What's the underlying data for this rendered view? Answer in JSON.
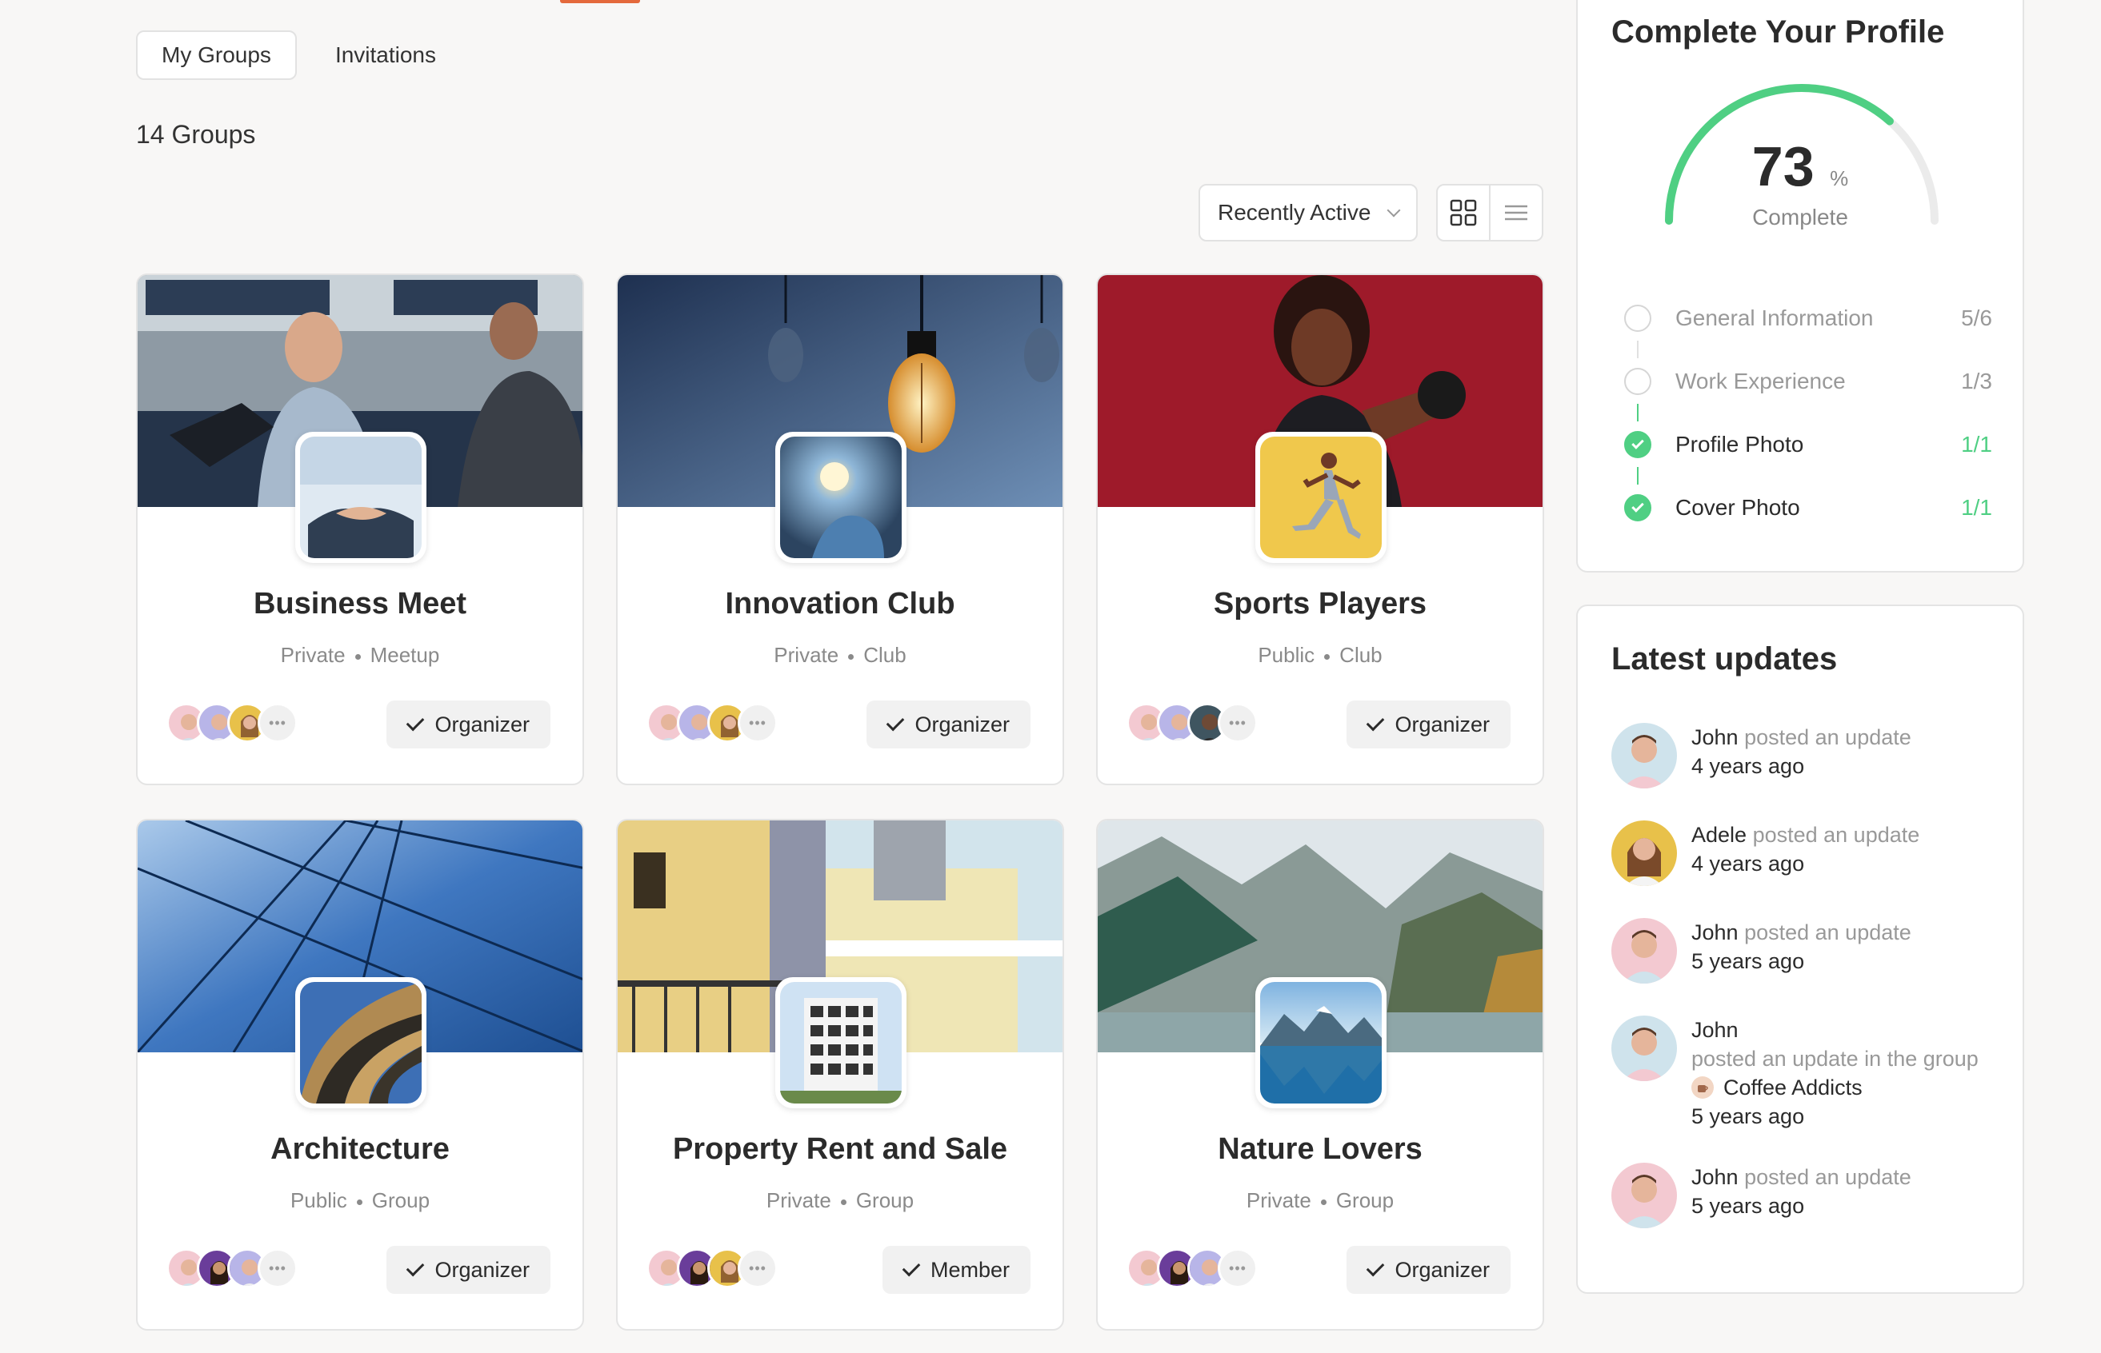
{
  "tabs": [
    {
      "label": "My Groups",
      "active": true
    },
    {
      "label": "Invitations",
      "active": false
    }
  ],
  "groups_count": "14 Groups",
  "sort": {
    "selected": "Recently Active"
  },
  "view_modes": [
    "grid-icon",
    "list-icon"
  ],
  "groups": [
    {
      "name": "Business Meet",
      "privacy": "Private",
      "type": "Meetup",
      "role": "Organizer"
    },
    {
      "name": "Innovation Club",
      "privacy": "Private",
      "type": "Club",
      "role": "Organizer"
    },
    {
      "name": "Sports Players",
      "privacy": "Public",
      "type": "Club",
      "role": "Organizer"
    },
    {
      "name": "Architecture",
      "privacy": "Public",
      "type": "Group",
      "role": "Organizer"
    },
    {
      "name": "Property Rent and Sale",
      "privacy": "Private",
      "type": "Group",
      "role": "Member"
    },
    {
      "name": "Nature Lovers",
      "privacy": "Private",
      "type": "Group",
      "role": "Organizer"
    }
  ],
  "more_members": "•••",
  "profile": {
    "title": "Complete Your Profile",
    "percent": "73",
    "percent_symbol": "%",
    "percent_label": "Complete",
    "progress": 0.73,
    "steps": [
      {
        "label": "General Information",
        "count": "5/6",
        "done": false
      },
      {
        "label": "Work Experience",
        "count": "1/3",
        "done": false
      },
      {
        "label": "Profile Photo",
        "count": "1/1",
        "done": true
      },
      {
        "label": "Cover Photo",
        "count": "1/1",
        "done": true
      }
    ]
  },
  "updates": {
    "title": "Latest updates",
    "items": [
      {
        "name": "John",
        "action": "posted an update",
        "time": "4 years ago"
      },
      {
        "name": "Adele",
        "action": "posted an update",
        "time": "4 years ago"
      },
      {
        "name": "John",
        "action": "posted an update",
        "time": "5 years ago"
      },
      {
        "name": "John",
        "action": "posted an update in the group",
        "group": "Coffee Addicts",
        "time": "5 years ago"
      },
      {
        "name": "John",
        "action": "posted an update",
        "time": "5 years ago"
      }
    ]
  },
  "colors": {
    "accent": "#e4693c",
    "success": "#4fcf83"
  }
}
